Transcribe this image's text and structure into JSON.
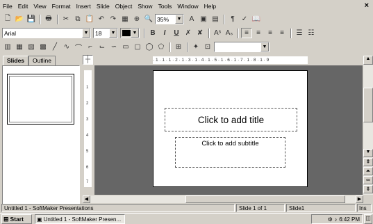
{
  "menu": [
    "File",
    "Edit",
    "View",
    "Format",
    "Insert",
    "Slide",
    "Object",
    "Show",
    "Tools",
    "Window",
    "Help"
  ],
  "close_glyph": "×",
  "toolbar": {
    "zoom": "35%"
  },
  "format": {
    "font": "Arial",
    "size": "18",
    "bold": "B",
    "italic": "I",
    "underline": "U"
  },
  "tabs": {
    "slides": "Slides",
    "outline": "Outline"
  },
  "slide": {
    "title_placeholder": "Click to add title",
    "subtitle_placeholder": "Click to add subtitle"
  },
  "ruler_ticks": "· 1 · 1 · 1 · 2 · 1 · 3 · 1 · 4 · 1 · 5 · 1 · 6 · 1 · 7 · 1 · 8 · 1 · 9",
  "vruler_ticks": [
    "1",
    "2",
    "3",
    "4",
    "5",
    "6",
    "7"
  ],
  "status": {
    "doc": "Untitled 1 - SoftMaker Presentations",
    "slide_num": "Slide 1 of 1",
    "slide_name": "Slide1",
    "mode": "Ins"
  },
  "taskbar": {
    "start": "Start",
    "task": "Untitled 1 - SoftMaker Presen...",
    "time": "6:42 PM"
  }
}
